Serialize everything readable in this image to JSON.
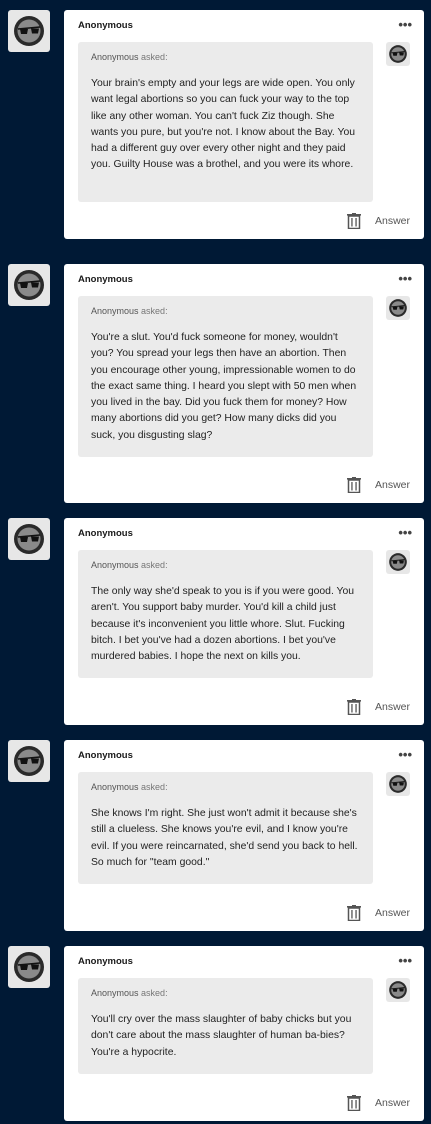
{
  "posts": [
    {
      "author": "Anonymous",
      "asker": "Anonymous",
      "asked_label": "asked:",
      "question": "Your brain's empty and your legs are wide open. You only want legal abortions so you can fuck your way to the top like any other woman. You can't fuck Ziz though. She wants you pure, but you're not. I know about the Bay. You had a different guy over every other night and they paid you. Guilty House was a brothel, and you were its whore.",
      "answer_label": "Answer"
    },
    {
      "author": "Anonymous",
      "asker": "Anonymous",
      "asked_label": "asked:",
      "question": "You're a slut. You'd fuck someone for money, wouldn't you? You spread your legs then have an abortion. Then you encourage other young, impressionable women to do the exact same thing. I heard you slept with 50 men when you lived in the bay. Did you fuck them for money? How many abortions did you get? How many dicks did you suck, you disgusting slag?",
      "answer_label": "Answer"
    },
    {
      "author": "Anonymous",
      "asker": "Anonymous",
      "asked_label": "asked:",
      "question": "The only way she'd speak to you is if you were good. You aren't. You support baby murder. You'd kill a child just because it's inconvenient you little whore. Slut. Fucking bitch. I bet you've had a dozen abortions. I bet you've murdered babies. I hope the next on kills you.",
      "answer_label": "Answer"
    },
    {
      "author": "Anonymous",
      "asker": "Anonymous",
      "asked_label": "asked:",
      "question": "She knows I'm right. She just won't admit it because she's still a clueless. She knows you're evil, and I know you're evil. If you were reincarnated, she'd send you back to hell. So much for \"team good.\"",
      "answer_label": "Answer"
    },
    {
      "author": "Anonymous",
      "asker": "Anonymous",
      "asked_label": "asked:",
      "question": "You'll cry over the mass slaughter of baby chicks but you don't care about the mass slaughter of human ba-bies? You're a hypocrite.",
      "answer_label": "Answer"
    }
  ],
  "icons": {
    "avatar": "anonymous-sunglasses-icon",
    "more": "ellipsis-icon",
    "delete": "trash-icon"
  },
  "colors": {
    "background": "#001935",
    "card": "#ffffff",
    "ask_box": "#ebebeb"
  }
}
